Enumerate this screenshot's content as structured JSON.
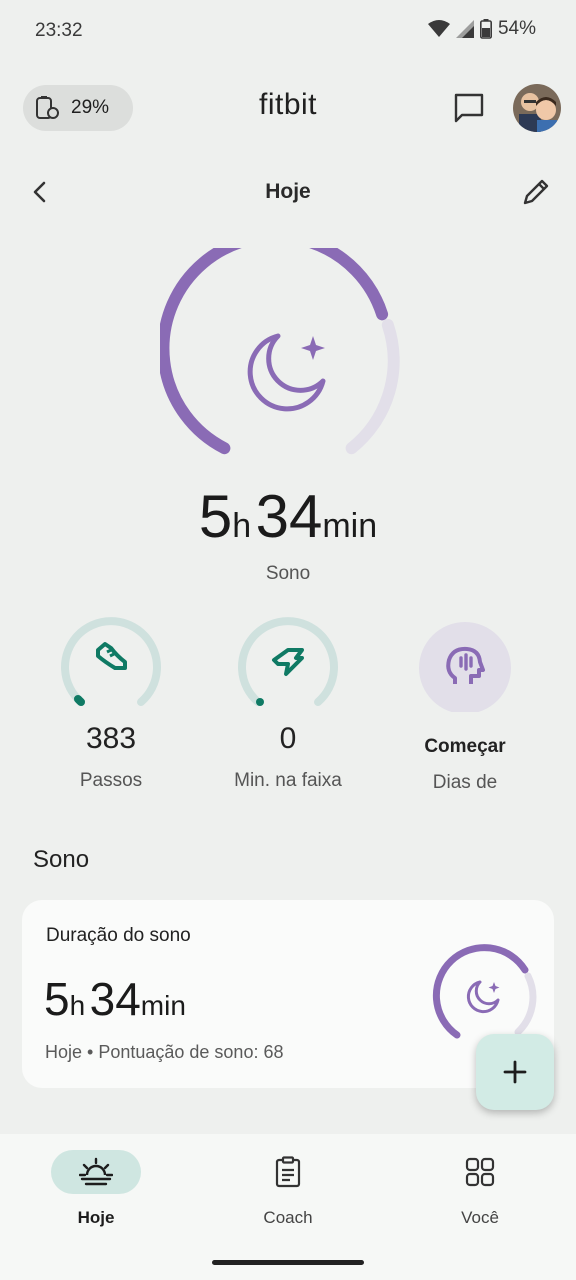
{
  "status_bar": {
    "time": "23:32",
    "battery": "54%"
  },
  "header": {
    "device_battery": "29%",
    "app_title": "fitbit"
  },
  "date_nav": {
    "title": "Hoje"
  },
  "hero": {
    "hours": "5",
    "hours_unit": "h",
    "minutes": "34",
    "minutes_unit": "min",
    "label": "Sono",
    "progress_fraction": 0.7
  },
  "stats": [
    {
      "value": "383",
      "label": "Passos"
    },
    {
      "value": "0",
      "label": "Min. na faixa"
    },
    {
      "value": "Começar",
      "label": "Dias de"
    }
  ],
  "section": {
    "title": "Sono",
    "card": {
      "title": "Duração do sono",
      "hours": "5",
      "hours_unit": "h",
      "minutes": "34",
      "minutes_unit": "min",
      "subtitle": "Hoje • Pontuação de sono: 68"
    }
  },
  "bottom_nav": [
    {
      "label": "Hoje",
      "active": true
    },
    {
      "label": "Coach",
      "active": false
    },
    {
      "label": "Você",
      "active": false
    }
  ],
  "colors": {
    "sleep": "#8a6bb5",
    "sleep_track": "#e2dfe9",
    "activity": "#0f7a64",
    "activity_track": "#cfe1de",
    "accent_bg": "#cfe6e1"
  }
}
